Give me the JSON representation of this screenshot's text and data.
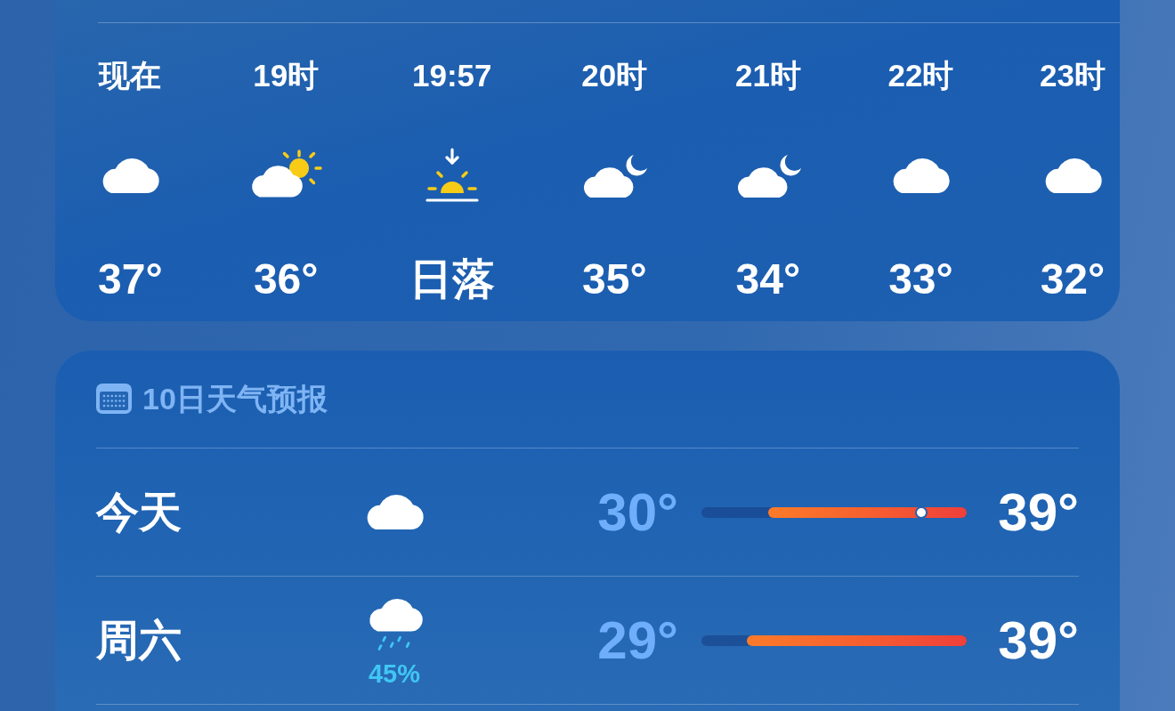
{
  "hourly_forecast": {
    "hours": [
      {
        "time": "现在",
        "kind": "cloudy",
        "value": "37°"
      },
      {
        "time": "19时",
        "kind": "partly-sunny",
        "value": "36°"
      },
      {
        "time": "19:57",
        "kind": "sunset",
        "value": "日落"
      },
      {
        "time": "20时",
        "kind": "partly-cloudy-night",
        "value": "35°"
      },
      {
        "time": "21时",
        "kind": "partly-cloudy-night",
        "value": "34°"
      },
      {
        "time": "22时",
        "kind": "cloudy",
        "value": "33°"
      },
      {
        "time": "23时",
        "kind": "cloudy",
        "value": "32°"
      }
    ]
  },
  "daily_forecast": {
    "title": "10日天气预报",
    "days": [
      {
        "day": "今天",
        "kind": "cloudy",
        "low": "30°",
        "high": "39°",
        "range": {
          "level": 0.75
        },
        "current": {
          "level": 0.83
        }
      },
      {
        "day": "周六",
        "kind": "rain",
        "precipitation": "45%",
        "low": "29°",
        "high": "39°",
        "range": {
          "level": 0.83
        }
      }
    ]
  }
}
